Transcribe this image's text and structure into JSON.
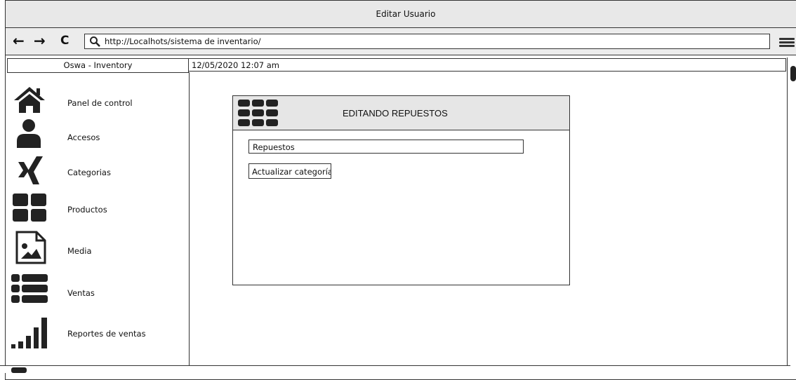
{
  "window": {
    "title": "Editar Usuario"
  },
  "browser": {
    "url": "http://Localhots/sistema de inventario/",
    "back_glyph": "←",
    "forward_glyph": "→",
    "reload_glyph": "C"
  },
  "header": {
    "brand": "Oswa - Inventory",
    "datetime": "12/05/2020 12:07 am"
  },
  "sidebar": {
    "items": [
      {
        "label": "Panel de control",
        "icon": "home-icon"
      },
      {
        "label": "Accesos",
        "icon": "user-icon"
      },
      {
        "label": "Categorias",
        "icon": "xing-icon"
      },
      {
        "label": "Productos",
        "icon": "grid-icon"
      },
      {
        "label": "Media",
        "icon": "image-icon"
      },
      {
        "label": "Ventas",
        "icon": "list-icon"
      },
      {
        "label": "Reportes de ventas",
        "icon": "signal-bars-icon"
      }
    ]
  },
  "panel": {
    "title": "EDITANDO REPUESTOS",
    "icon": "apps-grid-icon",
    "field_value": "Repuestos",
    "button_label": "Actualizar categoría"
  }
}
